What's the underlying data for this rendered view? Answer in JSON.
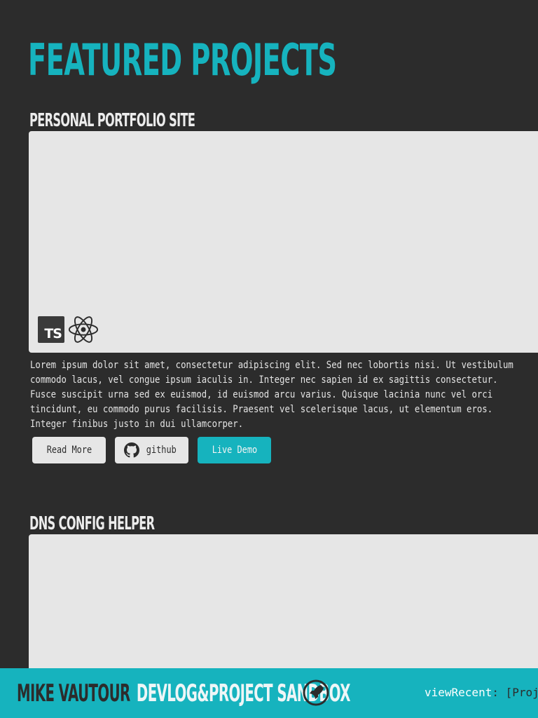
{
  "page": {
    "title": "FEATURED PROJECTS"
  },
  "projects": [
    {
      "title": "PERSONAL PORTFOLIO SITE",
      "tech": [
        "typescript-icon",
        "react-icon"
      ],
      "description": "Lorem ipsum dolor sit amet, consectetur adipiscing elit. Sed nec lobortis nisi. Ut vestibulum\ncommodo lacus, vel congue ipsum iaculis in. Integer nec sapien id ex sagittis consectetur.\nFusce suscipit urna sed ex euismod, id euismod arcu varius. Quisque lacinia nunc vel orci\ntincidunt, eu commodo purus facilisis. Praesent vel scelerisque lacus, ut elementum eros.\nInteger finibus justo in dui ullamcorper.",
      "buttons": {
        "read_more": "Read More",
        "github": "github",
        "live_demo": "Live Demo"
      }
    },
    {
      "title": "DNS CONFIG HELPER"
    }
  ],
  "footer": {
    "name": "MIKE VAUTOUR",
    "site": "DEVLOG&PROJECT SANDBOX",
    "code_key": "viewRecent",
    "code_rest": ": [Proj"
  },
  "colors": {
    "background": "#2c2c2c",
    "accent": "#16b3be",
    "card": "#e6e6e6"
  }
}
